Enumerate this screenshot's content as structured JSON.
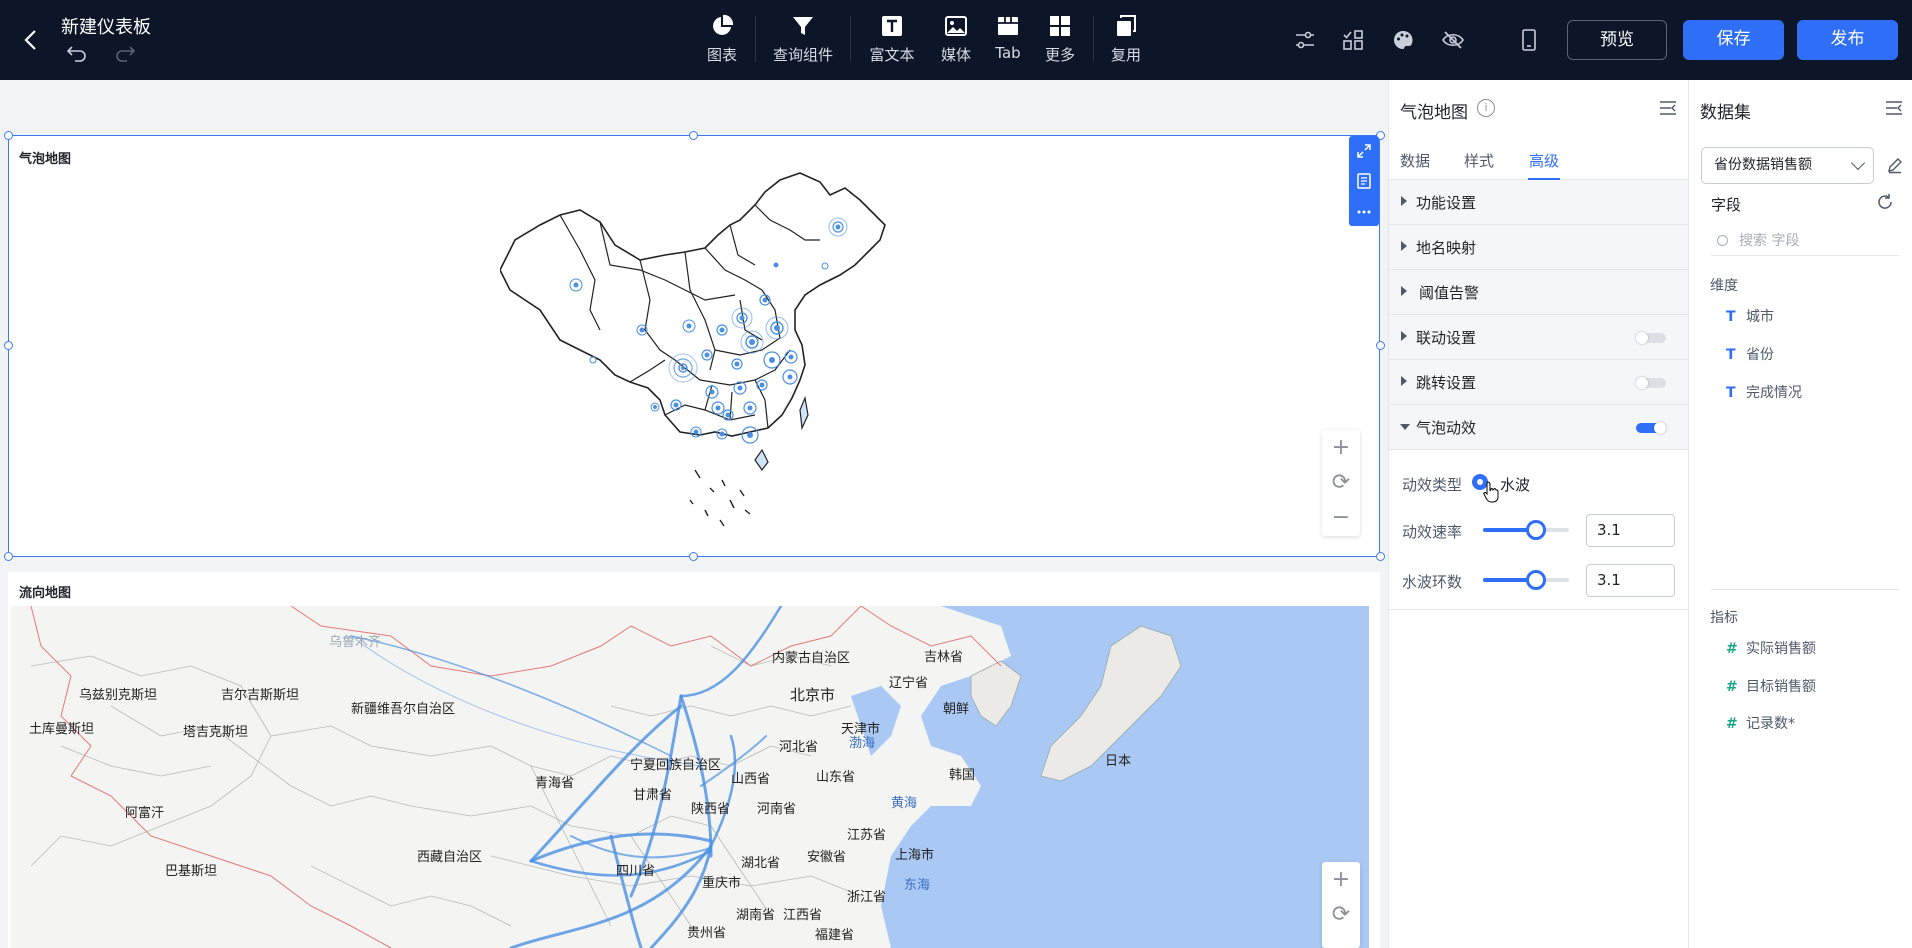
{
  "header": {
    "title": "新建仪表板",
    "toolbar": [
      {
        "label": "图表",
        "icon": "pie-chart-icon"
      },
      {
        "label": "查询组件",
        "icon": "filter-icon"
      },
      {
        "label": "富文本",
        "icon": "rich-text-icon"
      },
      {
        "label": "媒体",
        "icon": "image-icon"
      },
      {
        "label": "Tab",
        "icon": "tab-icon"
      },
      {
        "label": "更多",
        "icon": "grid-icon"
      },
      {
        "label": "复用",
        "icon": "copy-icon"
      }
    ],
    "preview_label": "预览",
    "save_label": "保存",
    "publish_label": "发布",
    "accent": "#2f6ef6",
    "bg": "#0d1628"
  },
  "canvas": {
    "card1": {
      "title": "气泡地图"
    },
    "card2": {
      "title": "流向地图",
      "labels": {
        "urumqi": "乌鲁木齐",
        "uzbek": "乌兹别克斯坦",
        "kyrgyz": "吉尔吉斯斯坦",
        "xinjiang": "新疆维吾尔自治区",
        "inner_mongolia": "内蒙古自治区",
        "jilin": "吉林省",
        "liaoning": "辽宁省",
        "turkmen": "土库曼斯坦",
        "tajik": "塔吉克斯坦",
        "beijing": "北京市",
        "tianjin": "天津市",
        "bohai": "渤海",
        "korea_n": "朝鲜",
        "hebei": "河北省",
        "ningxia": "宁夏回族自治区",
        "qinghai": "青海省",
        "shanxi": "山西省",
        "shandong": "山东省",
        "korea_s": "韩国",
        "japan": "日本",
        "gansu": "甘肃省",
        "afghan": "阿富汗",
        "shaanxi": "陕西省",
        "henan": "河南省",
        "yellow_sea": "黄海",
        "tibet": "西藏自治区",
        "jiangsu": "江苏省",
        "shanghai": "上海市",
        "pakistan": "巴基斯坦",
        "sichuan": "四川省",
        "hubei": "湖北省",
        "anhui": "安徽省",
        "east_sea": "东海",
        "chongqing": "重庆市",
        "zhejiang": "浙江省",
        "hunan": "湖南省",
        "jiangxi": "江西省",
        "guizhou": "贵州省",
        "fujian": "福建省"
      }
    }
  },
  "config_panel": {
    "title": "气泡地图",
    "tabs": [
      "数据",
      "样式",
      "高级"
    ],
    "active_tab": "高级",
    "sections": [
      {
        "label": "功能设置",
        "toggle": null,
        "expanded": false
      },
      {
        "label": "地名映射",
        "toggle": null,
        "expanded": false
      },
      {
        "label": "阈值告警",
        "toggle": null,
        "expanded": false
      },
      {
        "label": "联动设置",
        "toggle": false,
        "expanded": false
      },
      {
        "label": "跳转设置",
        "toggle": false,
        "expanded": false
      },
      {
        "label": "气泡动效",
        "toggle": true,
        "expanded": true
      }
    ],
    "effect_type_label": "动效类型",
    "effect_type_value": "水波",
    "speed_label": "动效速率",
    "speed_value": "3.1",
    "speed_fraction": 0.62,
    "rings_label": "水波环数",
    "rings_value": "3.1",
    "rings_fraction": 0.62
  },
  "dataset_panel": {
    "title": "数据集",
    "dataset": "省份数据销售额",
    "fields_label": "字段",
    "search_placeholder": "搜索 字段",
    "dimensions_label": "维度",
    "dimensions": [
      "城市",
      "省份",
      "完成情况"
    ],
    "measures_label": "指标",
    "measures": [
      "实际销售额",
      "目标销售额",
      "记录数*"
    ]
  }
}
